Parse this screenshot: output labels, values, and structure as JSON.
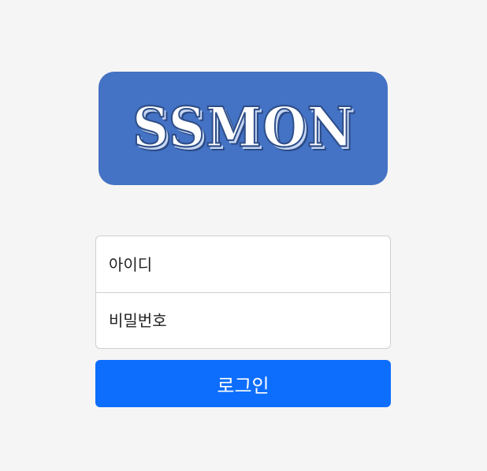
{
  "logo": {
    "text": "SSMON",
    "background_color": "#4472c4"
  },
  "login_form": {
    "id_placeholder": "아이디",
    "id_value": "",
    "password_placeholder": "비밀번호",
    "password_value": "",
    "submit_label": "로그인",
    "submit_color": "#0d6efd"
  }
}
